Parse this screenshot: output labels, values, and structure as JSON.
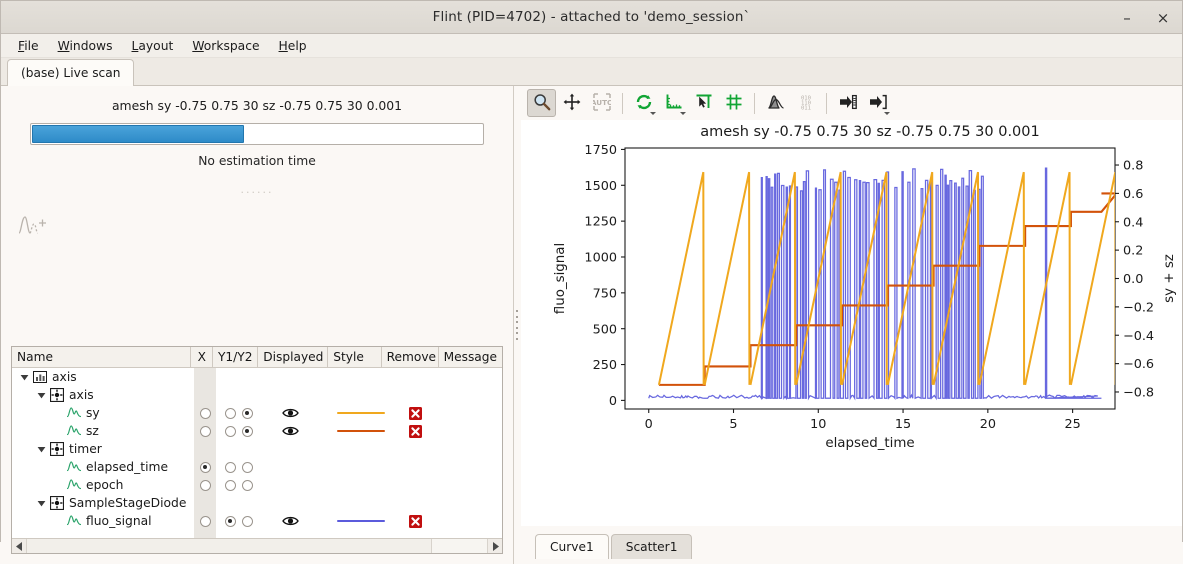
{
  "window": {
    "title": "Flint (PID=4702) - attached to 'demo_session`",
    "minimize_label": "–",
    "close_label": "×"
  },
  "menu": {
    "items": [
      {
        "label": "File",
        "accel": "F"
      },
      {
        "label": "Windows",
        "accel": "W"
      },
      {
        "label": "Layout",
        "accel": "L"
      },
      {
        "label": "Workspace",
        "accel": "W"
      },
      {
        "label": "Help",
        "accel": "H"
      }
    ]
  },
  "top_tabs": [
    {
      "label": "(base) Live scan",
      "active": true
    }
  ],
  "scan": {
    "command": "amesh sy -0.75 0.75 30 sz -0.75 0.75 30 0.001",
    "progress_percent": 47,
    "estimation": "No estimation time",
    "dots": "······",
    "progress_color": "#2e8bc8"
  },
  "tree": {
    "columns": [
      "Name",
      "X",
      "Y1/Y2",
      "Displayed",
      "Style",
      "Remove",
      "Message"
    ],
    "rows": [
      {
        "name": "axis",
        "depth": 0,
        "icon": "chart-icon",
        "expander": "expanded",
        "x": null,
        "y1": null,
        "y2": null,
        "displayed": false,
        "style": null,
        "remove": false
      },
      {
        "name": "axis",
        "depth": 1,
        "icon": "device-icon",
        "expander": "expanded",
        "x": null,
        "y1": null,
        "y2": null,
        "displayed": false,
        "style": null,
        "remove": false
      },
      {
        "name": "sy",
        "depth": 2,
        "icon": "curve-icon",
        "expander": "none",
        "x": false,
        "y1": false,
        "y2": true,
        "displayed": true,
        "style": "#f0a81e",
        "remove": true
      },
      {
        "name": "sz",
        "depth": 2,
        "icon": "curve-icon",
        "expander": "none",
        "x": false,
        "y1": false,
        "y2": true,
        "displayed": true,
        "style": "#d2520a",
        "remove": true
      },
      {
        "name": "timer",
        "depth": 1,
        "icon": "device-icon",
        "expander": "expanded",
        "x": null,
        "y1": null,
        "y2": null,
        "displayed": false,
        "style": null,
        "remove": false
      },
      {
        "name": "elapsed_time",
        "depth": 2,
        "icon": "curve-icon",
        "expander": "none",
        "x": true,
        "y1": false,
        "y2": false,
        "displayed": false,
        "style": null,
        "remove": false
      },
      {
        "name": "epoch",
        "depth": 2,
        "icon": "curve-icon",
        "expander": "none",
        "x": false,
        "y1": false,
        "y2": false,
        "displayed": false,
        "style": null,
        "remove": false
      },
      {
        "name": "SampleStageDiode",
        "depth": 1,
        "icon": "device-icon",
        "expander": "expanded",
        "x": null,
        "y1": null,
        "y2": null,
        "displayed": false,
        "style": null,
        "remove": false
      },
      {
        "name": "fluo_signal",
        "depth": 2,
        "icon": "curve-icon",
        "expander": "none",
        "x": false,
        "y1": true,
        "y2": false,
        "displayed": true,
        "style": "#5b5bdc",
        "remove": true
      }
    ]
  },
  "plot_toolbar": {
    "buttons": [
      {
        "name": "zoom-tool",
        "icon": "magnifier-icon",
        "checked": true,
        "enabled": true,
        "caret": false
      },
      {
        "name": "pan-tool",
        "icon": "move-arrows-icon",
        "checked": false,
        "enabled": true,
        "caret": false
      },
      {
        "name": "auto-scale-tool",
        "icon": "auto-icon",
        "checked": false,
        "enabled": false,
        "caret": false
      },
      {
        "name": "separator-1",
        "icon": "separator",
        "checked": false,
        "enabled": true,
        "caret": false
      },
      {
        "name": "reset-zoom-tool",
        "icon": "refresh-icon",
        "checked": false,
        "enabled": true,
        "caret": true
      },
      {
        "name": "axis-scale-tool",
        "icon": "axis-icon",
        "checked": false,
        "enabled": true,
        "caret": true
      },
      {
        "name": "crosshair-tool",
        "icon": "cursor-axis-icon",
        "checked": false,
        "enabled": true,
        "caret": false
      },
      {
        "name": "grid-tool",
        "icon": "grid-icon",
        "checked": false,
        "enabled": true,
        "caret": false
      },
      {
        "name": "separator-2",
        "icon": "separator",
        "checked": false,
        "enabled": true,
        "caret": false
      },
      {
        "name": "fit-curve-tool",
        "icon": "peak-icon",
        "checked": false,
        "enabled": true,
        "caret": false
      },
      {
        "name": "raw-data-tool",
        "icon": "binary-icon",
        "checked": false,
        "enabled": false,
        "caret": false
      },
      {
        "name": "separator-3",
        "icon": "separator",
        "checked": false,
        "enabled": true,
        "caret": false
      },
      {
        "name": "export-tool",
        "icon": "export-arrow-icon",
        "checked": false,
        "enabled": true,
        "caret": false
      },
      {
        "name": "save-tool",
        "icon": "save-arrow-icon",
        "checked": false,
        "enabled": true,
        "caret": true
      }
    ]
  },
  "bottom_tabs": [
    {
      "label": "Curve1",
      "active": true
    },
    {
      "label": "Scatter1",
      "active": false
    }
  ],
  "chart_data": {
    "type": "line",
    "title": "amesh sy -0.75 0.75 30 sz -0.75 0.75 30 0.001",
    "xlabel": "elapsed_time",
    "ylabel": "fluo_signal",
    "y2label": "sy + sz",
    "xlim": [
      -1.4,
      27.5
    ],
    "ylim": [
      -60,
      1760
    ],
    "y2lim": [
      -0.92,
      0.92
    ],
    "xticks": [
      0,
      5,
      10,
      15,
      20,
      25
    ],
    "yticks": [
      0,
      250,
      500,
      750,
      1000,
      1250,
      1500,
      1750
    ],
    "y2ticks": [
      -0.8,
      -0.6,
      -0.4,
      -0.2,
      0.0,
      0.2,
      0.4,
      0.6,
      0.8
    ],
    "grid": false,
    "legend": "none",
    "series": [
      {
        "name": "sy",
        "axis": "y2",
        "color": "#f0a81e",
        "shape": "sawtooth",
        "description": "Sawtooth ramp from -0.75 to 0.75, period ~2.7 s, 10 cycles",
        "period": 2.7,
        "min": -0.75,
        "max": 0.75,
        "start_x": 0.6,
        "cycles": 10
      },
      {
        "name": "sz",
        "axis": "y2",
        "color": "#d2520a",
        "shape": "staircase",
        "description": "Staircase rising from -0.75 to 0.60 in 10 steps of ~0.15",
        "steps": [
          -0.75,
          -0.62,
          -0.47,
          -0.33,
          -0.19,
          -0.05,
          0.09,
          0.23,
          0.37,
          0.47,
          0.6
        ],
        "step_width": 2.7,
        "start_x": 0.6
      },
      {
        "name": "fluo_signal",
        "axis": "y1",
        "color": "#5b5bdc",
        "shape": "spikes",
        "description": "Baseline near 0 with dense rectangular spikes reaching ~1620; spike density highest between t=7 and t=20",
        "baseline": 15,
        "peak": 1620,
        "burst_start": 6.6,
        "burst_end": 19.8,
        "isolated_spikes": [
          23.4
        ]
      }
    ]
  }
}
